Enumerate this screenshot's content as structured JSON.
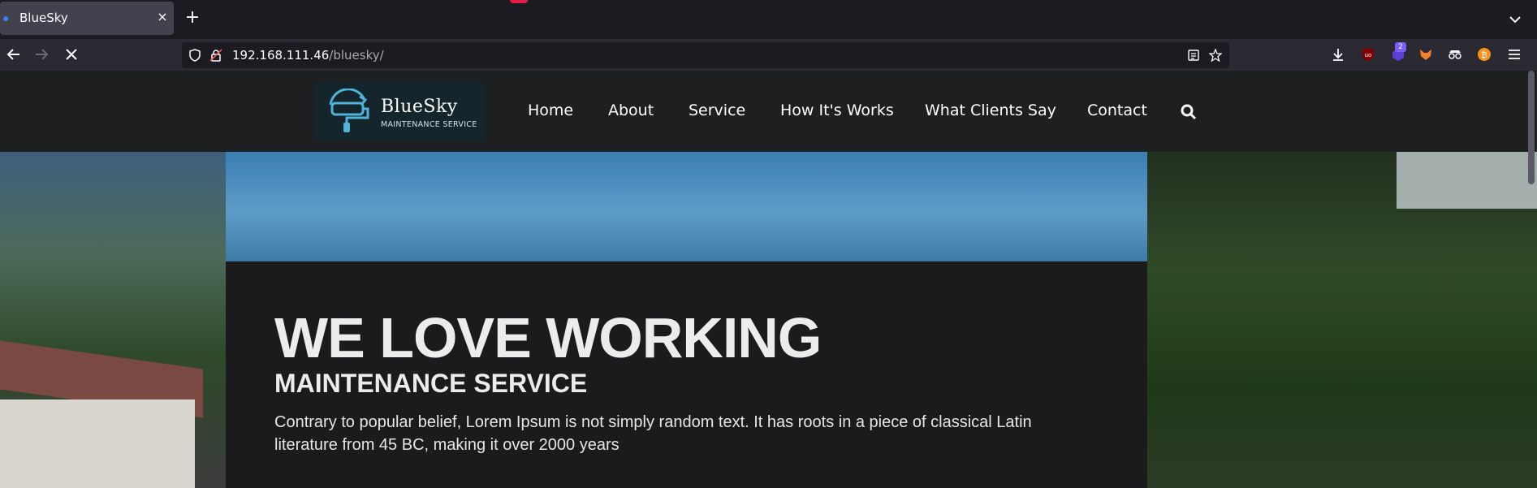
{
  "browser": {
    "tab_title": "BlueSky",
    "url_host": "192.168.111.46",
    "url_path": "/bluesky/",
    "extension_badge": "2"
  },
  "site": {
    "logo_name": "BlueSky",
    "logo_tagline": "MAINTENANCE SERVICE",
    "menu": [
      {
        "label": "Home"
      },
      {
        "label": "About"
      },
      {
        "label": "Service"
      },
      {
        "label": "How It's Works"
      },
      {
        "label": "What Clients Say"
      },
      {
        "label": "Contact"
      }
    ]
  },
  "hero": {
    "title": "WE LOVE WORKING",
    "subtitle": "MAINTENANCE SERVICE",
    "text": "Contrary to popular belief, Lorem Ipsum is not simply random text. It has roots in a piece of classical Latin literature from 45 BC, making it over 2000 years"
  },
  "colors": {
    "browser_bg": "#1c1b22",
    "toolbar_bg": "#2b2a33",
    "header_bg": "#1e1f21",
    "hero_box_bg": "#1b1b1e",
    "logo_blue": "#4fb3d9"
  }
}
